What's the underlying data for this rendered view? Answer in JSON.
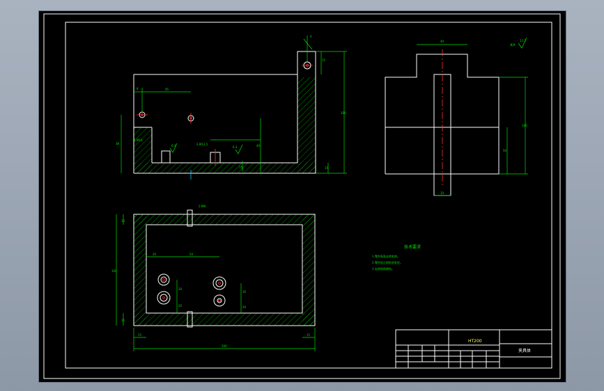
{
  "drawing": {
    "dims": {
      "front_top_gap": "8",
      "front_hole_spacing": "45",
      "front_right_width": "15",
      "front_height_total": "100",
      "front_left_height": "38",
      "front_inner_height": "40",
      "front_slot_label_left": "2-M10",
      "front_slot_label_mid": "2-M12.5",
      "front_bottom_thk": "15",
      "front_roughness_a": "6.3",
      "front_roughness_b": "6.3",
      "front_angle": "4",
      "side_top_width": "40",
      "side_height": "100",
      "side_mid_height": "50",
      "side_slot_width": "10",
      "plan_slot_label": "2-M8",
      "plan_left_dim": "10",
      "plan_height": "100",
      "plan_hole_x1": "20",
      "plan_hole_x2": "54",
      "plan_hole_y1": "20",
      "plan_hole_y2": "20",
      "plan_hole_y3": "30",
      "plan_hole_y4": "20",
      "plan_wall_left": "15",
      "plan_wall_right": "15",
      "plan_width": "200",
      "plan_bottom_thk": "15",
      "side_roughness_label": "其余",
      "side_roughness_value": "12.5"
    },
    "notes": {
      "title": "技术要求",
      "items": [
        "1.零件表面去除毛刺。",
        "2.零件加工前检验毛坯。",
        "3.去除锐角倒钝。"
      ]
    },
    "title_block": {
      "material": "HT200",
      "part_name": "夹具体"
    }
  }
}
